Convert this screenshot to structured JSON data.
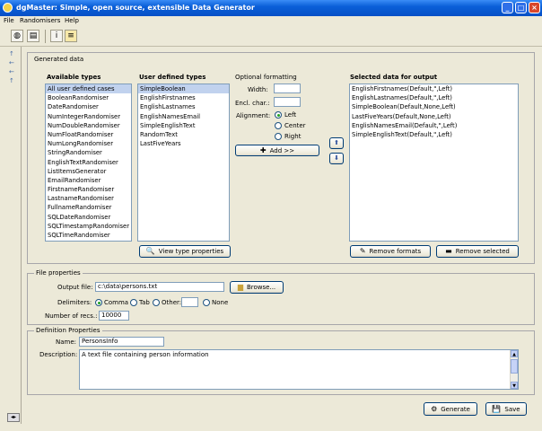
{
  "window": {
    "title": "dgMaster: Simple, open source, extensible Data Generator"
  },
  "menu": [
    "File",
    "Randomisers",
    "Help"
  ],
  "generated_data": {
    "heading": "Generated data",
    "available_types": {
      "heading": "Available types",
      "items": [
        "All user defined cases",
        "BooleanRandomiser",
        "DateRandomiser",
        "NumIntegerRandomiser",
        "NumDoubleRandomiser",
        "NumFloatRandomiser",
        "NumLongRandomiser",
        "StringRandomiser",
        "EnglishTextRandomiser",
        "ListItemsGenerator",
        "EmailRandomiser",
        "FirstnameRandomiser",
        "LastnameRandomiser",
        "FullnameRandomiser",
        "SQLDateRandomiser",
        "SQLTimestampRandomiser",
        "SQLTimeRandomiser"
      ]
    },
    "user_defined_types": {
      "heading": "User defined types",
      "items": [
        "SimpleBoolean",
        "EnglishFirstnames",
        "EnglishLastnames",
        "EnglishNamesEmail",
        "SimpleEnglishText",
        "RandomText",
        "LastFiveYears"
      ]
    },
    "view_type_properties_button": "View type properties",
    "optional_formatting": {
      "heading": "Optional formatting",
      "width_label": "Width:",
      "width_value": "",
      "encl_label": "Encl. char.:",
      "encl_value": "",
      "alignment_label": "Alignment:",
      "alignment_options": [
        "Left",
        "Center",
        "Right"
      ],
      "add_button": "Add >>"
    },
    "selected_data": {
      "heading": "Selected data for output",
      "items": [
        "EnglishFirstnames(Default,\",Left)",
        "EnglishLastnames(Default,\",Left)",
        "SimpleBoolean(Default,None,Left)",
        "LastFiveYears(Default,None,Left)",
        "EnglishNamesEmail(Default,\",Left)",
        "SimpleEnglishText(Default,\",Left)"
      ]
    },
    "remove_formats_button": "Remove formats",
    "remove_selected_button": "Remove selected"
  },
  "file_properties": {
    "heading": "File properties",
    "output_file_label": "Output file:",
    "output_file_value": "c:\\data\\persons.txt",
    "browse_button": "Browse...",
    "delimiters_label": "Delimiters:",
    "delimiter_options": [
      "Comma",
      "Tab",
      "Other:",
      "None"
    ],
    "other_value": "",
    "num_recs_label": "Number of recs.:",
    "num_recs_value": "10000"
  },
  "definition_properties": {
    "heading": "Definition Properties",
    "name_label": "Name:",
    "name_value": "PersonsInfo",
    "description_label": "Description:",
    "description_value": "A text file containing person information"
  },
  "footer": {
    "generate_button": "Generate",
    "save_button": "Save"
  },
  "icons": {
    "toolbar": [
      "globe-icon",
      "document-icon",
      "info-icon",
      "notepad-icon"
    ],
    "left_strip": [
      "arrow-up-icon",
      "arrow-left-icon",
      "arrow-left-icon",
      "arrow-up-icon"
    ]
  },
  "colors": {
    "titlebar": "#0a5fd8",
    "selection": "#c1d2ee",
    "background": "#ece9d8",
    "radio_on": "#21a121"
  }
}
